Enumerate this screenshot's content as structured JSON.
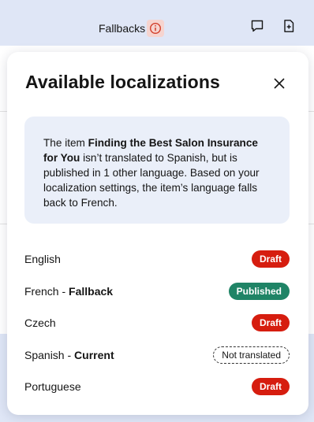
{
  "header": {
    "fallbacks_label": "Fallbacks"
  },
  "popover": {
    "title": "Available localizations",
    "info": {
      "prefix": "The item ",
      "item_name": "Finding the Best Salon Insurance for You",
      "suffix": " isn’t translated to Spanish, but is published in 1 other language. Based on your localization settings, the item’s language falls back to French."
    },
    "languages": [
      {
        "name": "English",
        "tag": "",
        "status": "Draft",
        "kind": "draft"
      },
      {
        "name": "French",
        "tag": "Fallback",
        "status": "Published",
        "kind": "published"
      },
      {
        "name": "Czech",
        "tag": "",
        "status": "Draft",
        "kind": "draft"
      },
      {
        "name": "Spanish",
        "tag": "Current",
        "status": "Not translated",
        "kind": "none"
      },
      {
        "name": "Portuguese",
        "tag": "",
        "status": "Draft",
        "kind": "draft"
      }
    ]
  },
  "colors": {
    "draft": "#d61d0f",
    "published": "#1f8466",
    "info_bg": "#eaeff9",
    "header_bg": "#dfe6f6"
  },
  "icons": [
    "info-icon",
    "comment-icon",
    "add-file-icon",
    "close-icon"
  ]
}
